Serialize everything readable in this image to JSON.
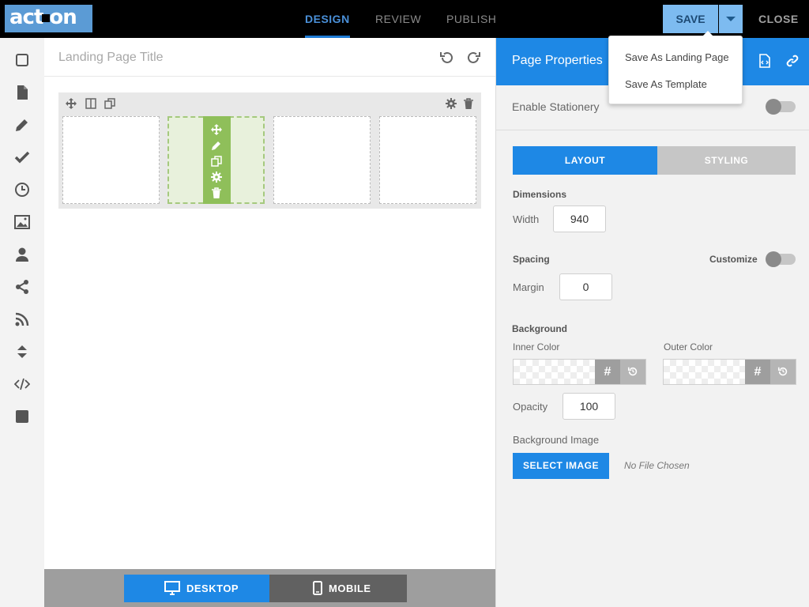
{
  "topbar": {
    "logo_left": "act",
    "logo_right": "on",
    "tabs": [
      {
        "label": "DESIGN",
        "active": true
      },
      {
        "label": "REVIEW",
        "active": false
      },
      {
        "label": "PUBLISH",
        "active": false
      }
    ],
    "save_label": "SAVE",
    "close_label": "CLOSE"
  },
  "save_menu": {
    "items": [
      "Save As Landing Page",
      "Save As Template"
    ]
  },
  "sidebar": {
    "icons": [
      "square-icon",
      "document-icon",
      "pencil-icon",
      "checkmark-icon",
      "clock-icon",
      "image-icon",
      "user-icon",
      "share-icon",
      "rss-icon",
      "resize-vertical-icon",
      "code-icon",
      "block-icon"
    ]
  },
  "canvas": {
    "title_placeholder": "Landing Page Title"
  },
  "device_toggle": {
    "desktop_label": "DESKTOP",
    "mobile_label": "MOBILE",
    "active": "desktop"
  },
  "panel": {
    "title": "Page Properties",
    "enable_stationery_label": "Enable Stationery",
    "enable_stationery_on": false,
    "tabs": {
      "layout": "LAYOUT",
      "styling": "STYLING",
      "active": "layout"
    },
    "dimensions_label": "Dimensions",
    "width_label": "Width",
    "width_value": "940",
    "spacing_label": "Spacing",
    "customize_label": "Customize",
    "customize_on": false,
    "margin_label": "Margin",
    "margin_value": "0",
    "background_label": "Background",
    "inner_color_label": "Inner Color",
    "outer_color_label": "Outer Color",
    "hash_symbol": "#",
    "opacity_label": "Opacity",
    "opacity_value": "100",
    "background_image_label": "Background Image",
    "select_image_label": "SELECT IMAGE",
    "no_file_label": "No File Chosen"
  },
  "colors": {
    "accent": "#1e88e5",
    "selected_column": "#8fbf5a",
    "topbar": "#000000"
  }
}
